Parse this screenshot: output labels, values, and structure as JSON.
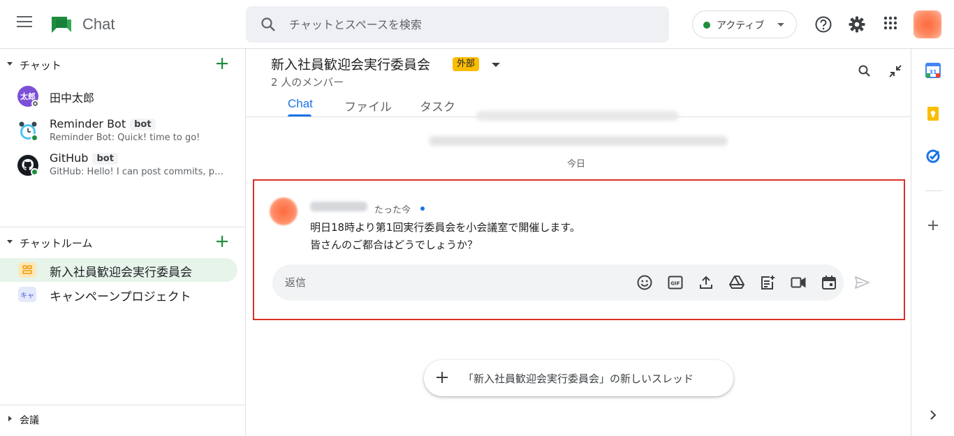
{
  "app": {
    "name": "Chat"
  },
  "search": {
    "placeholder": "チャットとスペースを検索"
  },
  "status": {
    "label": "アクティブ",
    "color": "#1e8e3e"
  },
  "icons": {
    "help": "help-icon",
    "settings": "gear-icon",
    "apps": "apps-grid-icon"
  },
  "sidebar": {
    "chats_header": "チャット",
    "chats": [
      {
        "name": "田中太郎",
        "avatar_text": "太郎",
        "avatar_color": "#7b4fd6"
      },
      {
        "name": "Reminder Bot",
        "badge": "bot",
        "preview": "Reminder Bot: Quick! time to go!"
      },
      {
        "name": "GitHub",
        "badge": "bot",
        "preview": "GitHub: Hello! I can post commits, pul..."
      }
    ],
    "rooms_header": "チャットルーム",
    "rooms": [
      {
        "name": "新入社員歓迎会実行委員会",
        "active": true
      },
      {
        "name": "キャンペーンプロジェクト",
        "icon_text": "キャ",
        "active": false
      }
    ],
    "meetings_header": "会議"
  },
  "room": {
    "title": "新入社員歓迎会実行委員会",
    "external_badge": "外部",
    "members": "2 人のメンバー",
    "tabs": [
      "Chat",
      "ファイル",
      "タスク"
    ],
    "active_tab": "Chat",
    "date_separator": "今日"
  },
  "thread": {
    "time": "たった今",
    "lines": [
      "明日18時より第1回実行委員会を小会議室で開催します。",
      "皆さんのご都合はどうでしょうか？"
    ],
    "reply_placeholder": "返信",
    "highlight_color": "#d93025"
  },
  "new_thread_label": "「新入社員歓迎会実行委員会」の新しいスレッド",
  "accent_color": "#1a73e8"
}
